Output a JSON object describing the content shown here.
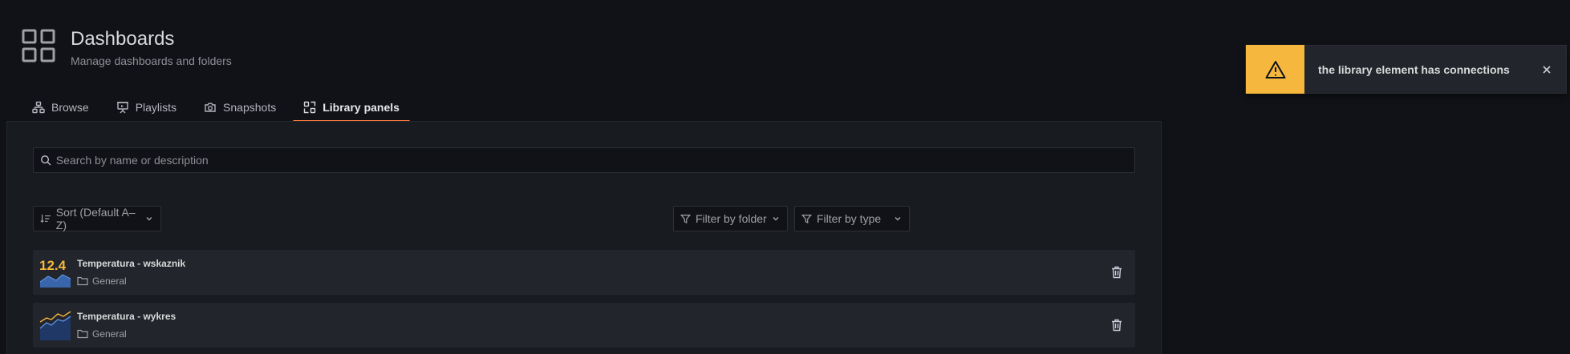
{
  "header": {
    "title": "Dashboards",
    "subtitle": "Manage dashboards and folders",
    "icon": "apps-grid-icon"
  },
  "tabs": [
    {
      "label": "Browse",
      "icon": "sitemap-icon",
      "active": false
    },
    {
      "label": "Playlists",
      "icon": "presentation-icon",
      "active": false
    },
    {
      "label": "Snapshots",
      "icon": "camera-icon",
      "active": false
    },
    {
      "label": "Library panels",
      "icon": "library-panel-icon",
      "active": true
    }
  ],
  "search": {
    "placeholder": "Search by name or description",
    "value": ""
  },
  "sort": {
    "label": "Sort (Default A–Z)"
  },
  "filters": {
    "folder": "Filter by folder",
    "type": "Filter by type"
  },
  "panels": [
    {
      "name": "Temperatura - wskaznik",
      "folder": "General",
      "stat": "12.4",
      "viz": "stat"
    },
    {
      "name": "Temperatura - wykres",
      "folder": "General",
      "viz": "timeseries"
    }
  ],
  "toast": {
    "message": "the library element has connections",
    "severity": "warning",
    "color": "#f5b73d"
  },
  "colors": {
    "accent": "#ff7c3b",
    "background": "#111217",
    "panel": "#181b1f"
  }
}
